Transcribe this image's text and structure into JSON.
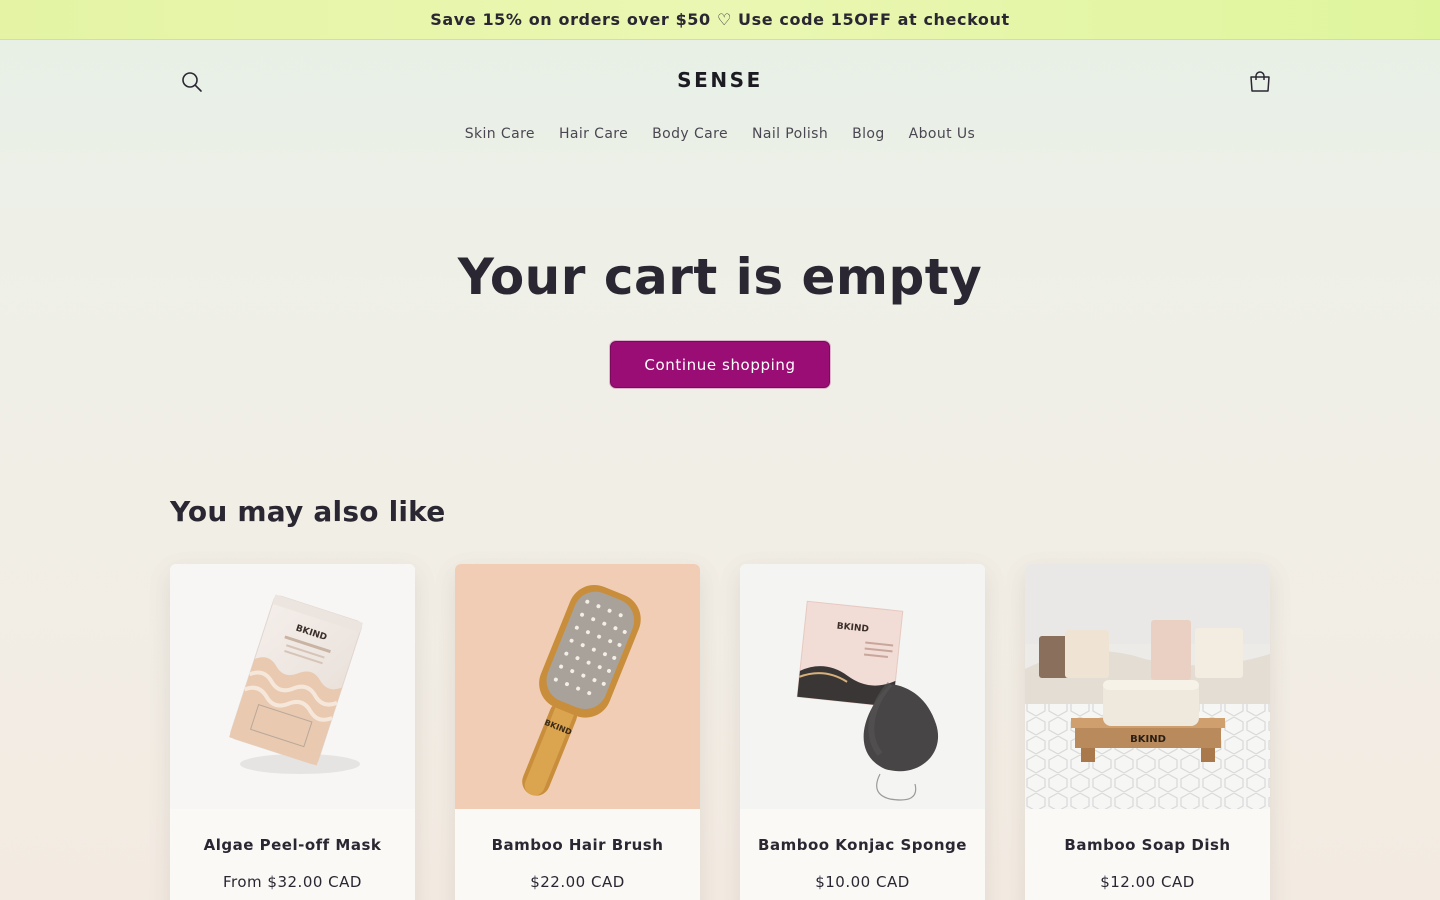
{
  "announcement": {
    "text": "Save 15% on orders over $50 ♡ Use code 15OFF at checkout"
  },
  "header": {
    "logo": "SENSE",
    "search_icon": "search-icon",
    "cart_icon": "cart-icon"
  },
  "nav": {
    "items": [
      {
        "label": "Skin Care"
      },
      {
        "label": "Hair Care"
      },
      {
        "label": "Body Care"
      },
      {
        "label": "Nail Polish"
      },
      {
        "label": "Blog"
      },
      {
        "label": "About Us"
      }
    ]
  },
  "cart": {
    "empty_title": "Your cart is empty",
    "continue_label": "Continue shopping"
  },
  "recommendations": {
    "title": "You may also like",
    "products": [
      {
        "name": "Algae Peel-off Mask",
        "price": "From $32.00 CAD",
        "brand": "BKIND"
      },
      {
        "name": "Bamboo Hair Brush",
        "price": "$22.00 CAD",
        "brand": "BKIND"
      },
      {
        "name": "Bamboo Konjac Sponge",
        "price": "$10.00 CAD",
        "brand": "BKIND"
      },
      {
        "name": "Bamboo Soap Dish",
        "price": "$12.00 CAD",
        "brand": "BKIND"
      }
    ]
  },
  "colors": {
    "accent": "#9a0d74",
    "announcement_bg": "#e4f4a4",
    "text": "#2a2732"
  }
}
